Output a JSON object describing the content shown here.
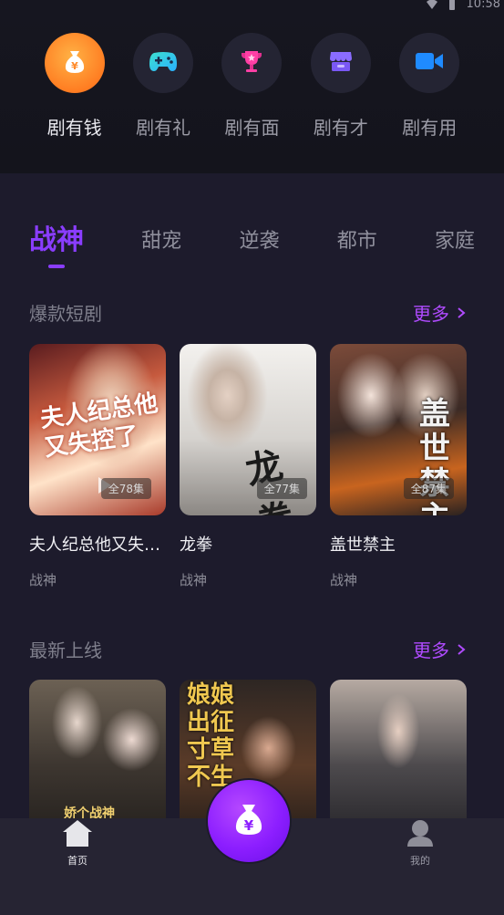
{
  "status_bar": {
    "time": "10:58"
  },
  "top_nav": [
    {
      "label": "剧有钱",
      "icon": "money-bag-icon",
      "active": true
    },
    {
      "label": "剧有礼",
      "icon": "gamepad-icon",
      "active": false
    },
    {
      "label": "剧有面",
      "icon": "trophy-icon",
      "active": false
    },
    {
      "label": "剧有才",
      "icon": "shop-icon",
      "active": false
    },
    {
      "label": "剧有用",
      "icon": "video-camera-icon",
      "active": false
    }
  ],
  "tabs": [
    {
      "label": "战神",
      "active": true
    },
    {
      "label": "甜宠",
      "active": false
    },
    {
      "label": "逆袭",
      "active": false
    },
    {
      "label": "都市",
      "active": false
    },
    {
      "label": "家庭",
      "active": false
    }
  ],
  "hot_section": {
    "title": "爆款短剧",
    "more": "更多",
    "items": [
      {
        "title": "夫人纪总他又失…",
        "genre": "战神",
        "episodes": "全78集",
        "poster_text": "夫人纪总他又失控了"
      },
      {
        "title": "龙拳",
        "genre": "战神",
        "episodes": "全77集",
        "poster_text": "龙拳"
      },
      {
        "title": "盖世禁主",
        "genre": "战神",
        "episodes": "全87集",
        "poster_text": "盖世禁主"
      }
    ]
  },
  "new_section": {
    "title": "最新上线",
    "more": "更多",
    "items": [
      {
        "poster_text": "娇个战神"
      },
      {
        "poster_text": "娘娘出征 寸草不生"
      },
      {
        "poster_text": ""
      }
    ]
  },
  "bottom_bar": {
    "home_label": "首页",
    "me_label": "我的"
  },
  "colors": {
    "accent": "#8a3dff",
    "more_link": "#b04bff",
    "active_nav": "#ff8a2a"
  }
}
